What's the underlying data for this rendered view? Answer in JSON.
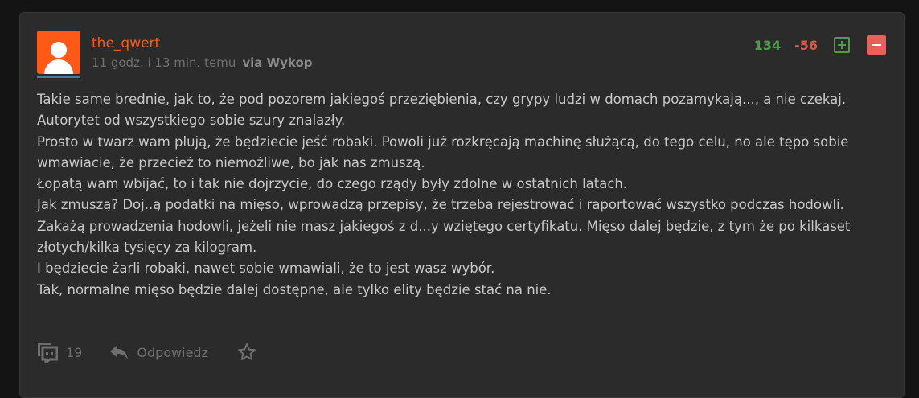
{
  "post": {
    "author": "the_qwert",
    "time": "11 godz. i 13 min. temu",
    "via": "via Wykop",
    "votes": {
      "up": "134",
      "down": "-56"
    },
    "paragraphs": [
      "Takie same brednie, jak to, że pod pozorem jakiegoś przeziębienia, czy grypy ludzi w domach pozamykają..., a nie czekaj.",
      "Autorytet od wszystkiego sobie szury znalazły.",
      "Prosto w twarz wam plują, że będziecie jeść robaki. Powoli już rozkręcają machinę służącą, do tego celu, no ale tępo sobie wmawiacie, że przecież to niemożliwe, bo jak nas zmuszą.",
      "Łopatą wam wbijać, to i tak nie dojrzycie, do czego rządy były zdolne w ostatnich latach.",
      "Jak zmuszą? Doj..ą podatki na mięso, wprowadzą przepisy, że trzeba rejestrować i raportować wszystko podczas hodowli. Zakażą prowadzenia hodowli, jeżeli nie masz jakiegoś z d...y wziętego certyfikatu. Mięso dalej będzie, z tym że po kilkaset złotych/kilka tysięcy za kilogram.",
      "I będziecie żarli robaki, nawet sobie wmawiali, że to jest wasz wybór.",
      "Tak, normalne mięso będzie dalej dostępne, ale tylko elity będzie stać na nie."
    ],
    "footer": {
      "comments_count": "19",
      "reply_label": "Odpowiedz"
    }
  },
  "colors": {
    "accent": "#ff5917",
    "upvote": "#4f9c4c",
    "downvote": "#e8625a",
    "text": "#c8c8c8",
    "muted": "#6f6f6f"
  },
  "icons": {
    "avatar": "user-avatar-icon",
    "plus": "plus-icon",
    "minus": "minus-icon",
    "comments": "comments-icon",
    "reply": "reply-icon",
    "favorite": "star-icon"
  }
}
